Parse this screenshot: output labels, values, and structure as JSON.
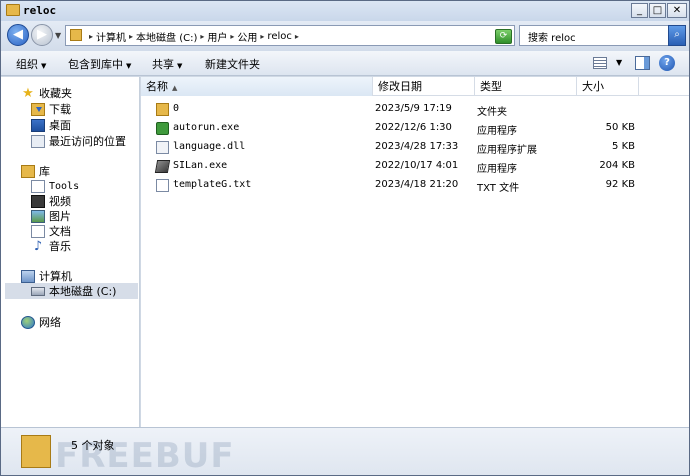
{
  "window": {
    "title": "reloc"
  },
  "window_buttons": {
    "minimize": "_",
    "maximize": "□",
    "close": "✕"
  },
  "address": {
    "crumbs": [
      "计算机",
      "本地磁盘 (C:)",
      "用户",
      "公用",
      "reloc"
    ]
  },
  "search": {
    "text": "搜索 reloc"
  },
  "toolbar": {
    "organize": "组织",
    "include_library": "包含到库中",
    "share": "共享",
    "new_folder": "新建文件夹"
  },
  "nav": {
    "favorites": "收藏夹",
    "downloads": "下载",
    "desktop": "桌面",
    "recent": "最近访问的位置",
    "libraries": "库",
    "tools": "Tools",
    "videos": "视频",
    "pictures": "图片",
    "documents": "文档",
    "music": "音乐",
    "computer": "计算机",
    "local_disk": "本地磁盘 (C:)",
    "network": "网络"
  },
  "columns": {
    "name": "名称",
    "date": "修改日期",
    "type": "类型",
    "size": "大小"
  },
  "files": [
    {
      "name": "0",
      "date": "2023/5/9 17:19",
      "type": "文件夹",
      "size": "",
      "icon": "folder-icon"
    },
    {
      "name": "autorun.exe",
      "date": "2022/12/6 1:30",
      "type": "应用程序",
      "size": "50 KB",
      "icon": "exe-green-icon"
    },
    {
      "name": "language.dll",
      "date": "2023/4/28 17:33",
      "type": "应用程序扩展",
      "size": "5 KB",
      "icon": "dll-icon"
    },
    {
      "name": "SILan.exe",
      "date": "2022/10/17 4:01",
      "type": "应用程序",
      "size": "204 KB",
      "icon": "exe-drive-icon"
    },
    {
      "name": "templateG.txt",
      "date": "2023/4/18 21:20",
      "type": "TXT 文件",
      "size": "92 KB",
      "icon": "txt-icon"
    }
  ],
  "status": {
    "item_count": "5 个对象"
  },
  "watermark": "FREEBUF",
  "colors": {
    "selection": "#d6dde8",
    "accent": "#2a62c4",
    "folder": "#e6b84a"
  }
}
